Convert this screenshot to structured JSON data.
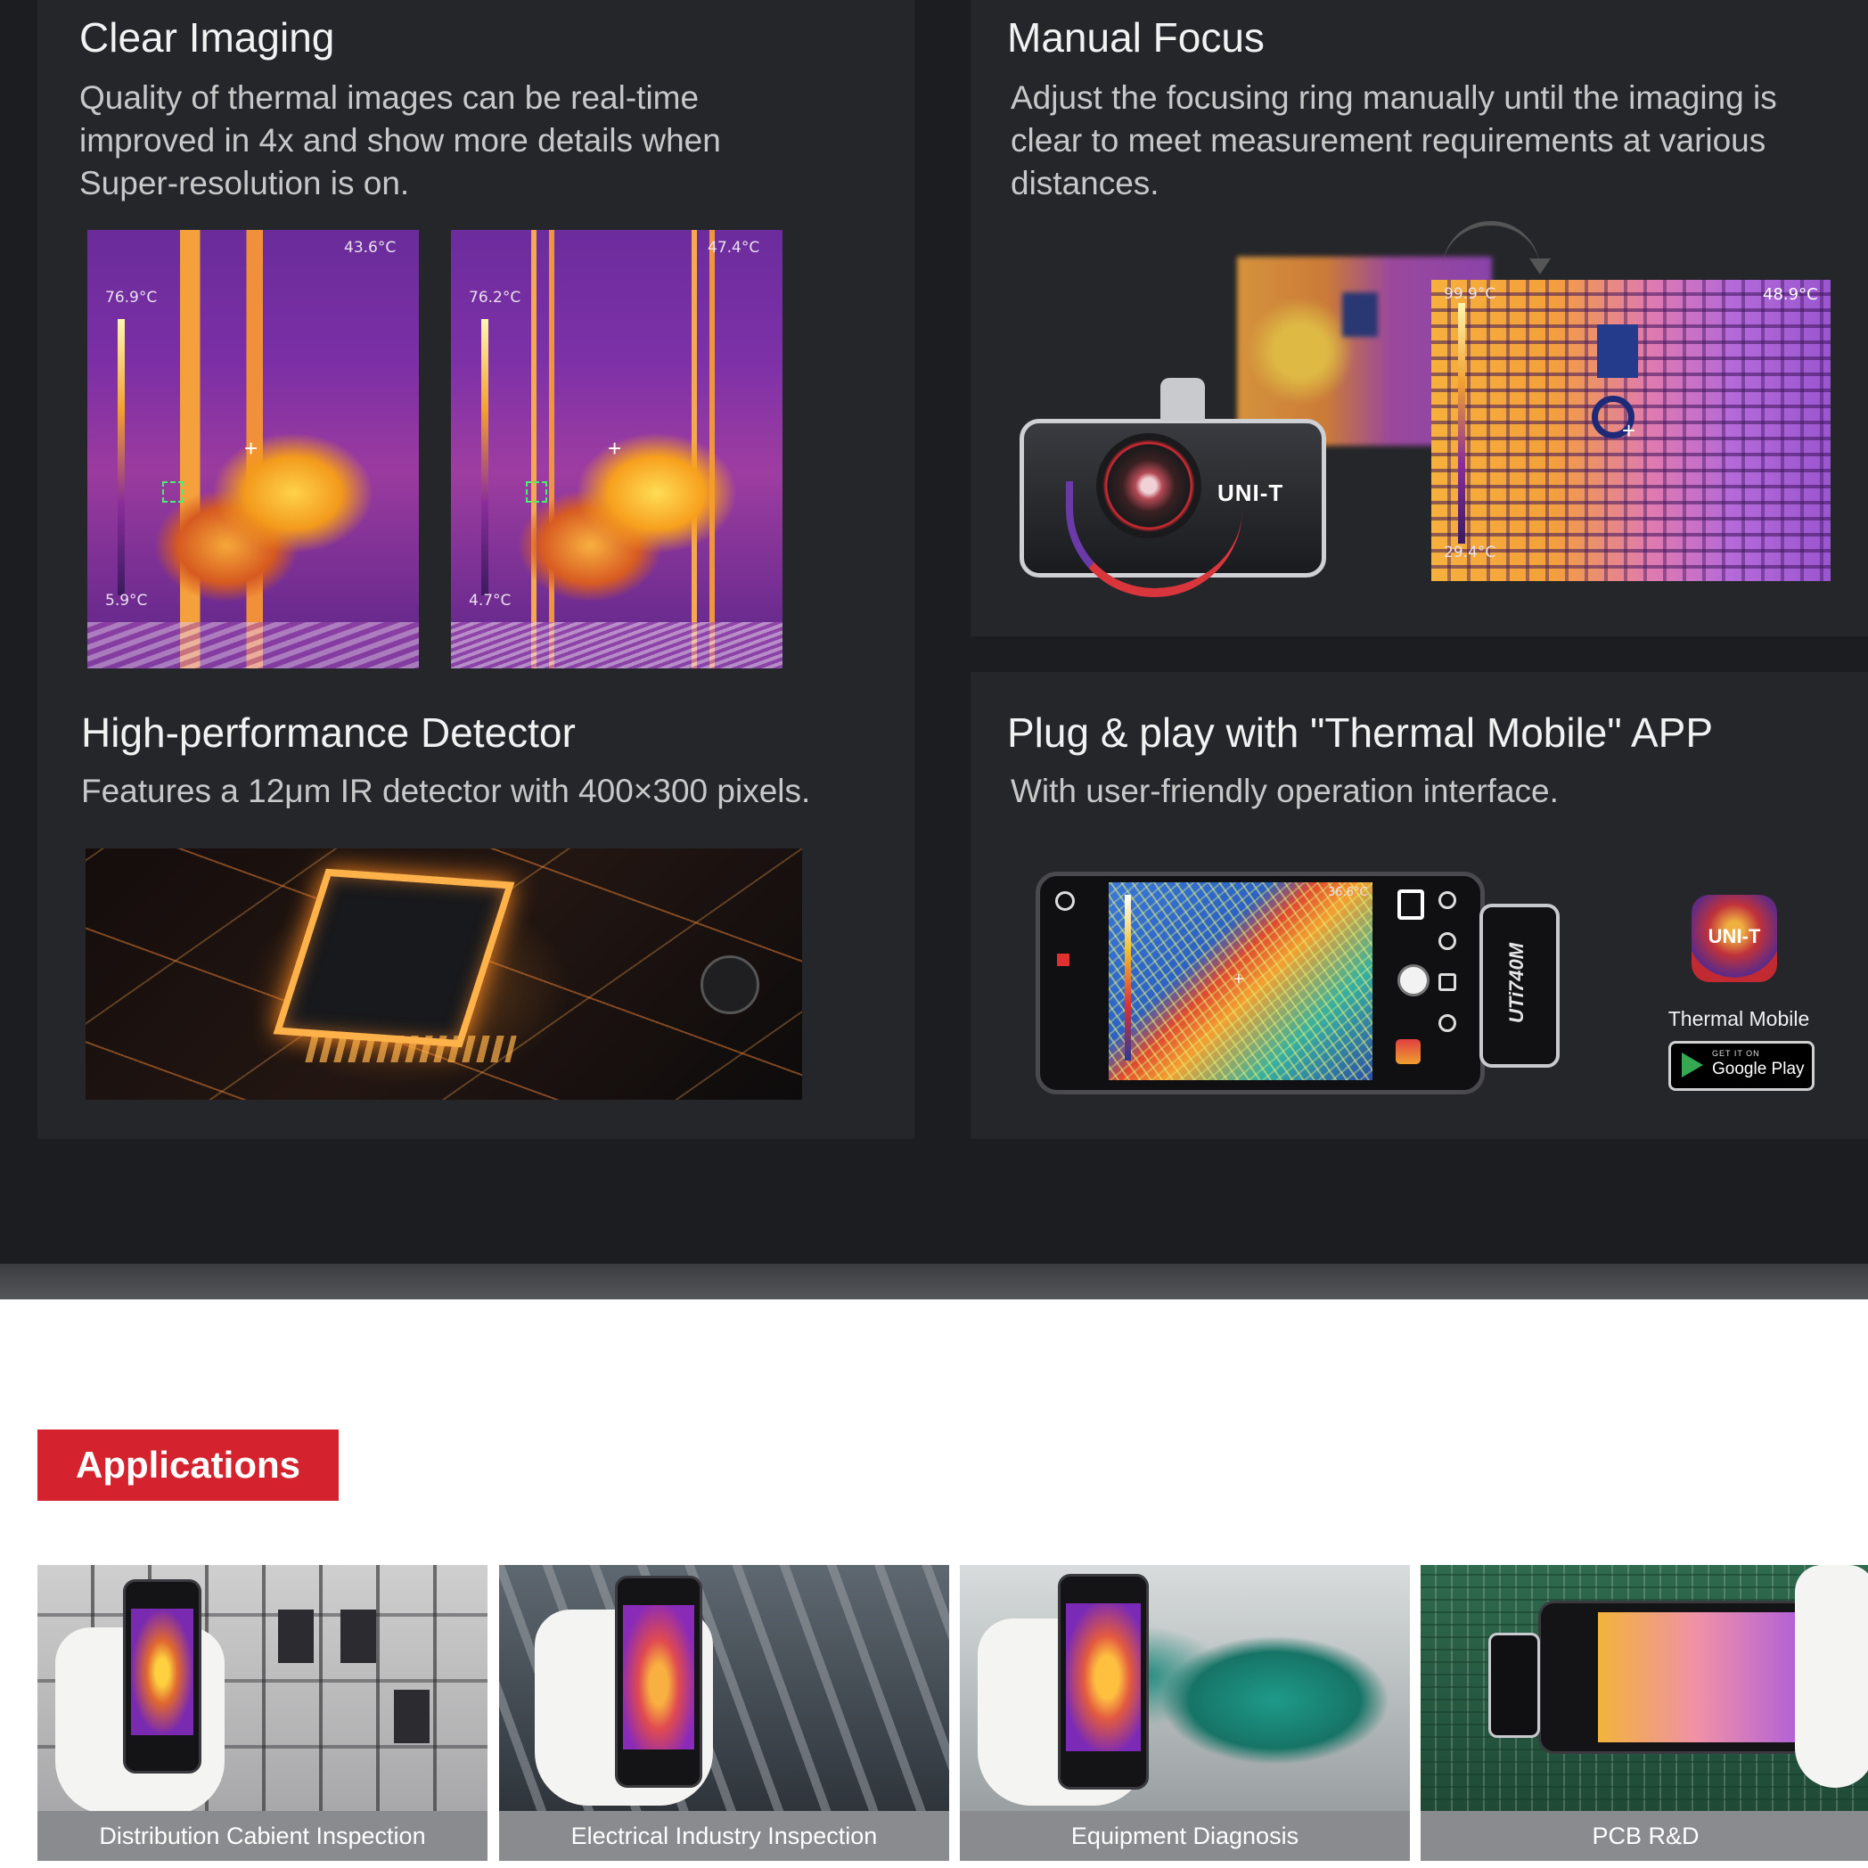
{
  "features": {
    "clear_imaging": {
      "title": "Clear Imaging",
      "desc": "Quality of thermal images can be real-time improved in 4x and show more details when Super-resolution is on.",
      "left_image": {
        "max_temp": "43.6°C",
        "scale_top": "76.9°C",
        "scale_bottom": "5.9°C"
      },
      "right_image": {
        "max_temp": "47.4°C",
        "scale_top": "76.2°C",
        "scale_bottom": "4.7°C"
      }
    },
    "manual_focus": {
      "title": "Manual Focus",
      "desc": "Adjust the focusing ring manually until the imaging is clear to meet measurement requirements at various distances.",
      "brand": "UNI-T",
      "image": {
        "max_temp": "48.9°C",
        "scale_top": "99.9°C",
        "scale_bottom": "29.4°C"
      }
    },
    "detector": {
      "title": "High-performance Detector",
      "desc": "Features a 12μm IR detector with 400×300 pixels."
    },
    "app": {
      "title": "Plug & play with \"Thermal Mobile\" APP",
      "desc": "With user-friendly operation interface.",
      "phone_temp": "36.6°C",
      "device_model": "UTi740M",
      "app_icon_label": "UNI-T",
      "app_name": "Thermal Mobile",
      "store_small": "GET IT ON",
      "store_big": "Google Play"
    }
  },
  "applications": {
    "heading": "Applications",
    "items": [
      {
        "label": "Distribution Cabient Inspection"
      },
      {
        "label": "Electrical Industry Inspection"
      },
      {
        "label": "Equipment Diagnosis"
      },
      {
        "label": "PCB R&D"
      }
    ]
  },
  "colors": {
    "accent_red": "#d4232e",
    "panel": "#25262a",
    "background": "#1c1d20"
  }
}
